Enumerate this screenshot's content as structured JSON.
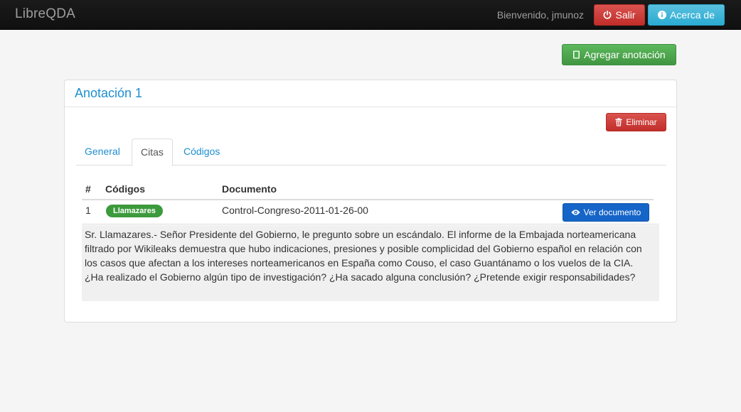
{
  "navbar": {
    "brand": "LibreQDA",
    "welcome": "Bienvenido, jmunoz",
    "logout_label": "Salir",
    "about_label": "Acerca de"
  },
  "toolbar": {
    "add_annotation_label": "Agregar anotación"
  },
  "panel": {
    "title": "Anotación 1",
    "delete_label": "Eliminar",
    "tabs": [
      {
        "label": "General",
        "active": false
      },
      {
        "label": "Citas",
        "active": true
      },
      {
        "label": "Códigos",
        "active": false
      }
    ],
    "table": {
      "headers": [
        "#",
        "Códigos",
        "Documento"
      ],
      "rows": [
        {
          "num": "1",
          "code": "Llamazares",
          "document": "Control-Congreso-2011-01-26-00",
          "view_label": "Ver documento",
          "quote": "Sr. Llamazares.- Señor Presidente del Gobierno, le pregunto sobre un escándalo. El informe de la Embajada norteamericana filtrado por Wikileaks demuestra que hubo indicaciones, presiones y posible complicidad del Gobierno español en relación con los casos que afectan a los intereses norteamericanos en España como Couso, el caso Guantánamo o los vuelos de la CIA. ¿Ha realizado el Gobierno algún tipo de investigación? ¿Ha sacado alguna conclusión? ¿Pretende exigir responsabilidades?"
        }
      ]
    }
  },
  "icons": {
    "logout": "power-icon",
    "about": "info-icon",
    "add": "book-icon",
    "delete": "trash-icon",
    "view": "eye-icon"
  },
  "colors": {
    "link": "#1e8fd0",
    "danger": "#d9534f",
    "info": "#5bc0de",
    "success": "#5cb85c",
    "primary": "#1565c8",
    "code_label": "#3c9a3c"
  }
}
